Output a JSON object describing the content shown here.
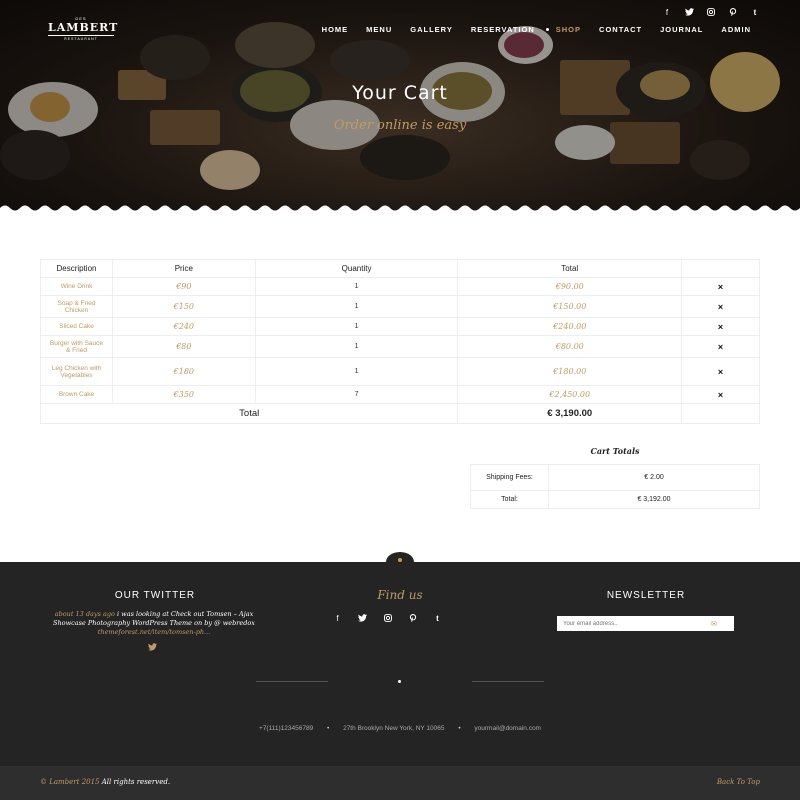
{
  "header": {
    "logo": {
      "small": "DES",
      "name": "LAMBERT",
      "tag": "RESTAURANT"
    },
    "social_icons": [
      "facebook-icon",
      "twitter-icon",
      "instagram-icon",
      "pinterest-icon",
      "tumblr-icon"
    ],
    "nav": [
      {
        "label": "HOME"
      },
      {
        "label": "MENU"
      },
      {
        "label": "GALLERY"
      },
      {
        "label": "RESERVATION"
      },
      {
        "label": "SHOP"
      },
      {
        "label": "CONTACT"
      },
      {
        "label": "JOURNAL"
      },
      {
        "label": "ADMIN"
      }
    ],
    "active_nav": "SHOP",
    "title": "Your Cart",
    "subtitle": "Order online is easy"
  },
  "cart": {
    "headers": {
      "description": "Description",
      "price": "Price",
      "quantity": "Quantity",
      "total": "Total"
    },
    "rows": [
      {
        "description": "Wine Drink",
        "price": "€90",
        "quantity": "1",
        "total": "€90.00",
        "remove": "×"
      },
      {
        "description": "Soap & Fried Chicken",
        "price": "€150",
        "quantity": "1",
        "total": "€150.00",
        "remove": "×"
      },
      {
        "description": "Sliced Cake",
        "price": "€240",
        "quantity": "1",
        "total": "€240.00",
        "remove": "×"
      },
      {
        "description": "Burger with Sauce & Fried",
        "price": "€80",
        "quantity": "1",
        "total": "€80.00",
        "remove": "×"
      },
      {
        "description": "Leg Chicken with Vegetables",
        "price": "€180",
        "quantity": "1",
        "total": "€180.00",
        "remove": "×"
      },
      {
        "description": "Brown Cake",
        "price": "€350",
        "quantity": "7",
        "total": "€2,450.00",
        "remove": "×"
      }
    ],
    "summary_label": "Total",
    "summary_value": "€ 3,190.00"
  },
  "totals": {
    "title": "Cart Totals",
    "shipping_label": "Shipping Fees:",
    "shipping_value": "€ 2.00",
    "total_label": "Total:",
    "total_value": "€ 3,192.00"
  },
  "footer": {
    "twitter_heading": "OUR TWITTER",
    "tweet_time": "about 13 days ago",
    "tweet_text": "i was looking at Check out Tomsen – Ajax Showcase Photography WordPress Theme on by @ webredox",
    "tweet_link": "themeforest.net/item/tomsen-ph...",
    "find_heading": "Find us",
    "newsletter_heading": "NEWSLETTER",
    "newsletter_placeholder": "Your email address..",
    "phone": "+7(111)123456789",
    "address": "27th Brooklyn New York, NY 10065",
    "email": "yourmail@domain.com",
    "copyright_brand": "© Lambert 2015",
    "copyright_text": "All rights reserved.",
    "back_to_top": "Back To Top"
  },
  "colors": {
    "accent": "#c29a63",
    "footer_bg": "#242424",
    "bottom_bg": "#2e2e2e"
  }
}
